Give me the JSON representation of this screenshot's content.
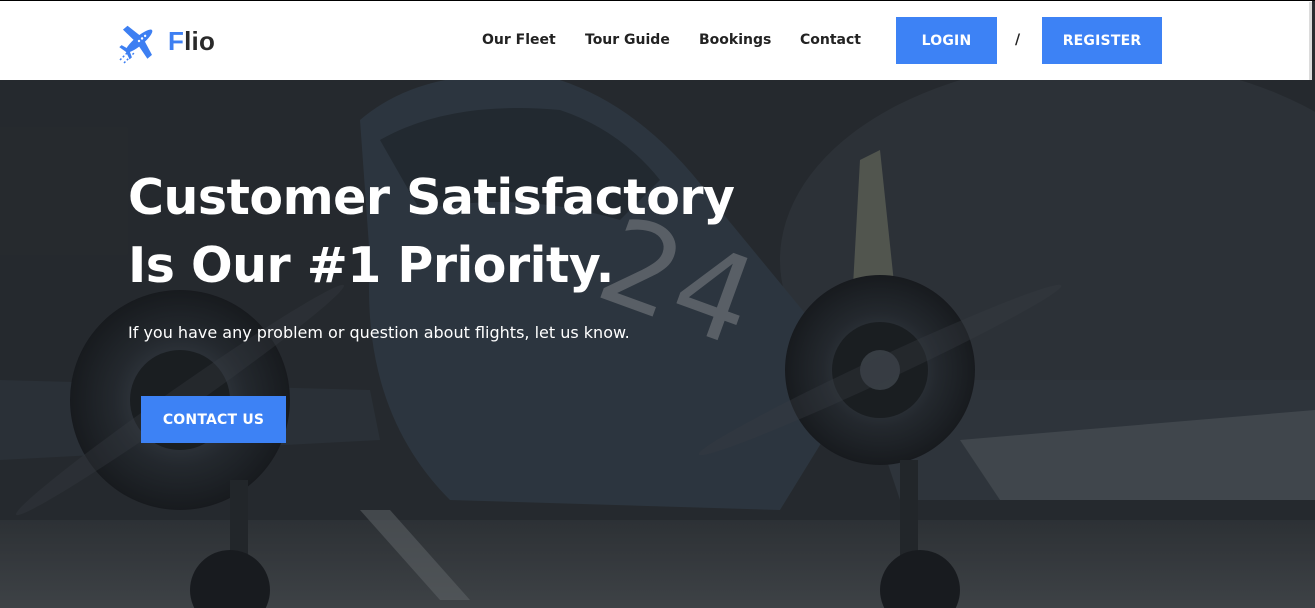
{
  "brand": {
    "first_letter": "F",
    "rest": "lio",
    "icon": "airplane-logo-icon",
    "accent": "#3d7ff2"
  },
  "nav": {
    "items": [
      {
        "label": "Our Fleet"
      },
      {
        "label": "Tour Guide"
      },
      {
        "label": "Bookings"
      },
      {
        "label": "Contact"
      }
    ],
    "login_label": "LOGIN",
    "separator": "/",
    "register_label": "REGISTER"
  },
  "hero": {
    "title_line1": "Customer Satisfactory",
    "title_line2": "Is Our #1 Priority.",
    "subtitle": "If you have any problem or question about flights, let us know.",
    "cta_label": "CONTACT US",
    "background": "vintage-propeller-airplane-photo"
  },
  "colors": {
    "button": "#3d82f5",
    "header_bg": "#ffffff",
    "hero_text": "#ffffff"
  }
}
